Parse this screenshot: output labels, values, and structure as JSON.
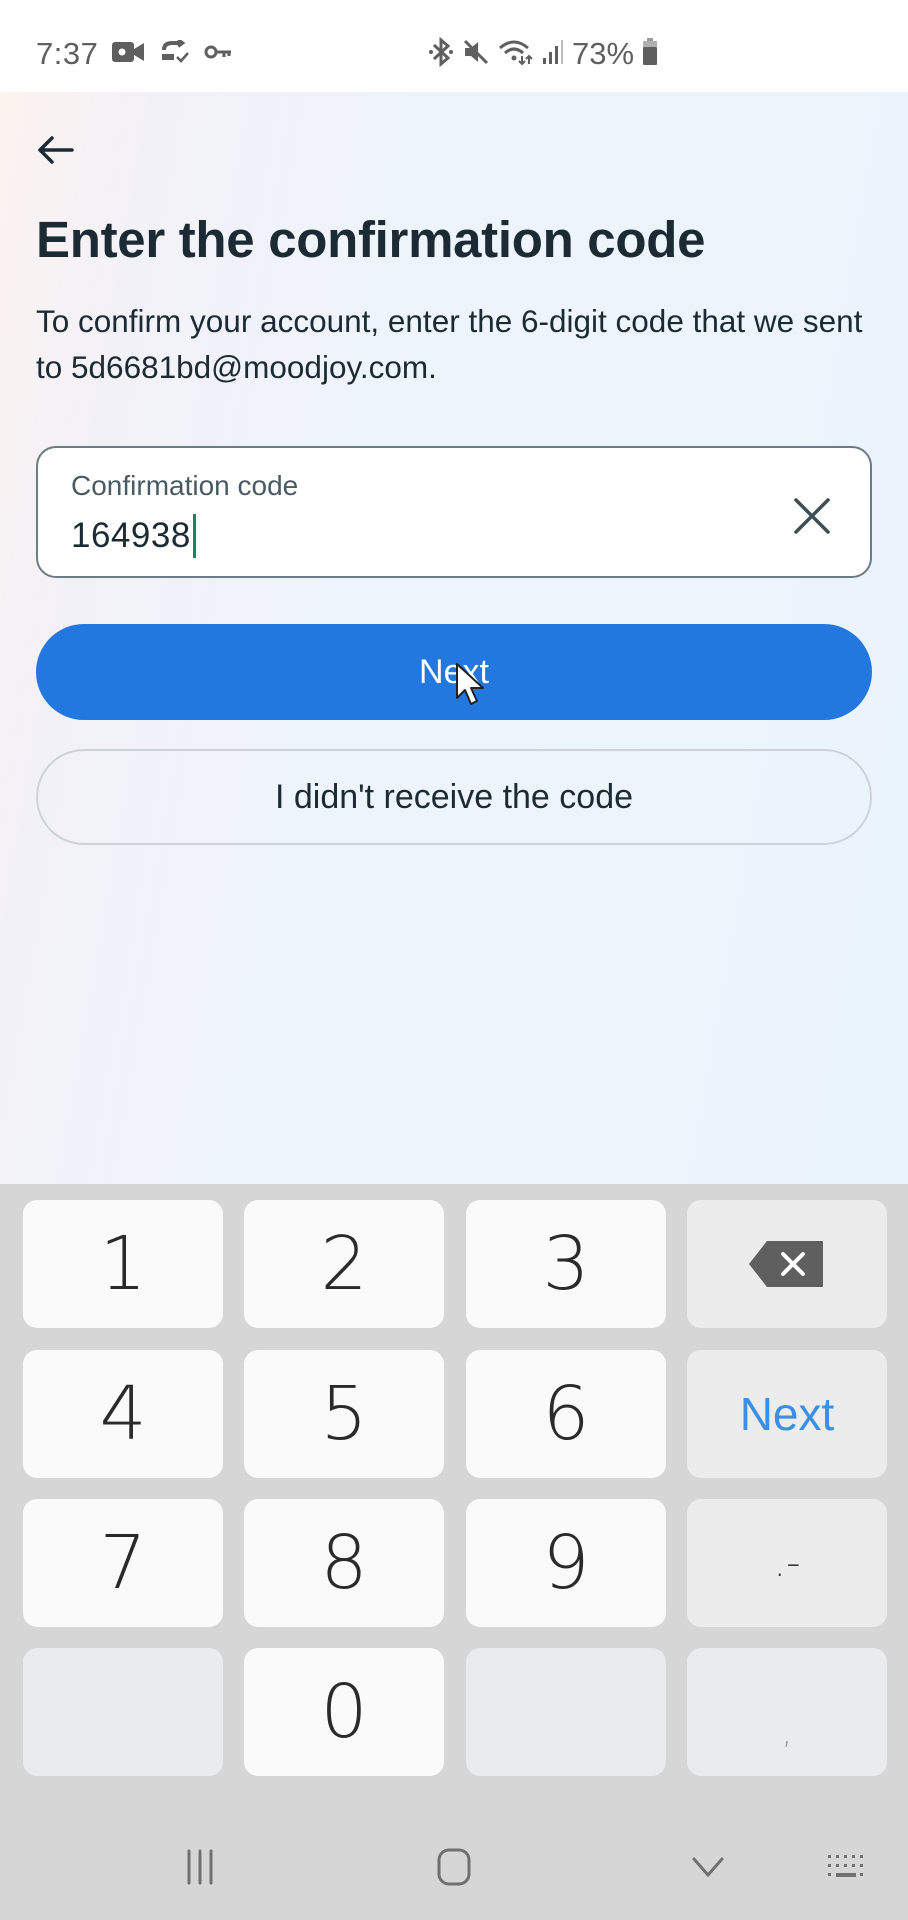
{
  "status_bar": {
    "time": "7:37",
    "left_icons": [
      "video-camera-icon",
      "sync-check-icon",
      "key-icon"
    ],
    "right_icons": [
      "bluetooth-icon",
      "mute-icon",
      "wifi-icon",
      "signal-icon"
    ],
    "battery_percent": "73%",
    "battery_icon": "battery-icon"
  },
  "page": {
    "back_icon": "arrow-left-icon",
    "title": "Enter the confirmation code",
    "description": "To confirm your account, enter the 6-digit code that we sent to 5d6681bd@moodjoy.com.",
    "code_field": {
      "label": "Confirmation code",
      "value": "164938",
      "clear_icon": "close-icon"
    },
    "next_button": "Next",
    "no_code_button": "I didn't receive the code",
    "brand_color": "#2378e0"
  },
  "keyboard": {
    "rows": [
      [
        {
          "label": "1"
        },
        {
          "label": "2"
        },
        {
          "label": "3"
        },
        {
          "label": "",
          "icon": "backspace-icon"
        }
      ],
      [
        {
          "label": "4"
        },
        {
          "label": "5"
        },
        {
          "label": "6"
        },
        {
          "label": "Next"
        }
      ],
      [
        {
          "label": "7"
        },
        {
          "label": "8"
        },
        {
          "label": "9"
        },
        {
          "label": ".-"
        }
      ],
      [
        {
          "label": ""
        },
        {
          "label": "0"
        },
        {
          "label": ""
        },
        {
          "label": ","
        }
      ]
    ],
    "next_color": "#3b8fe6"
  },
  "nav_bar": {
    "items": [
      "recent-apps-icon",
      "home-icon",
      "hide-keyboard-icon",
      "keyboard-switch-icon"
    ]
  }
}
